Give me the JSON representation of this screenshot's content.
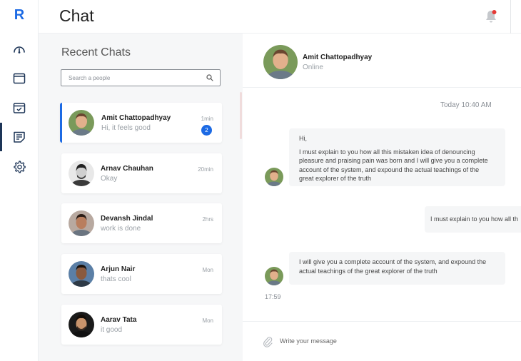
{
  "app": {
    "logo": "R",
    "title": "Chat"
  },
  "colors": {
    "accent": "#1c6ae4",
    "notification_dot": "#e53935",
    "panel_bg": "#f6f7f8"
  },
  "sidebar": {
    "items": [
      {
        "icon": "speedometer-icon"
      },
      {
        "icon": "window-icon"
      },
      {
        "icon": "calendar-check-icon"
      },
      {
        "icon": "note-icon",
        "active": true
      },
      {
        "icon": "gear-icon"
      }
    ]
  },
  "header": {
    "notification_icon": "bell-icon",
    "has_unread": true
  },
  "chat_list": {
    "title": "Recent Chats",
    "search_placeholder": "Search a people",
    "items": [
      {
        "name": "Amit Chattopadhyay",
        "preview": "Hi, it feels good",
        "time": "1min",
        "unread": "2",
        "active": true
      },
      {
        "name": "Arnav Chauhan",
        "preview": "Okay",
        "time": "20min"
      },
      {
        "name": "Devansh Jindal",
        "preview": "work is done",
        "time": "2hrs"
      },
      {
        "name": "Arjun Nair",
        "preview": "thats cool",
        "time": "Mon"
      },
      {
        "name": "Aarav Tata",
        "preview": "it good",
        "time": "Mon"
      }
    ]
  },
  "conversation": {
    "contact_name": "Amit Chattopadhyay",
    "contact_status": "Online",
    "day_label": "Today 10:40 AM",
    "messages": [
      {
        "from": "them",
        "greeting": "Hi,",
        "text": "I must explain to you how all this mistaken idea of denouncing pleasure and praising pain was born and I will give you a complete account of the system, and expound the actual teachings of the great explorer of the truth"
      },
      {
        "from": "me",
        "text": "I must explain to you how all th"
      },
      {
        "from": "them",
        "text": "I will give you a complete account of the system, and expound the actual teachings of the great explorer of the truth",
        "time": "17:59"
      }
    ],
    "composer_placeholder": "Write your message"
  }
}
